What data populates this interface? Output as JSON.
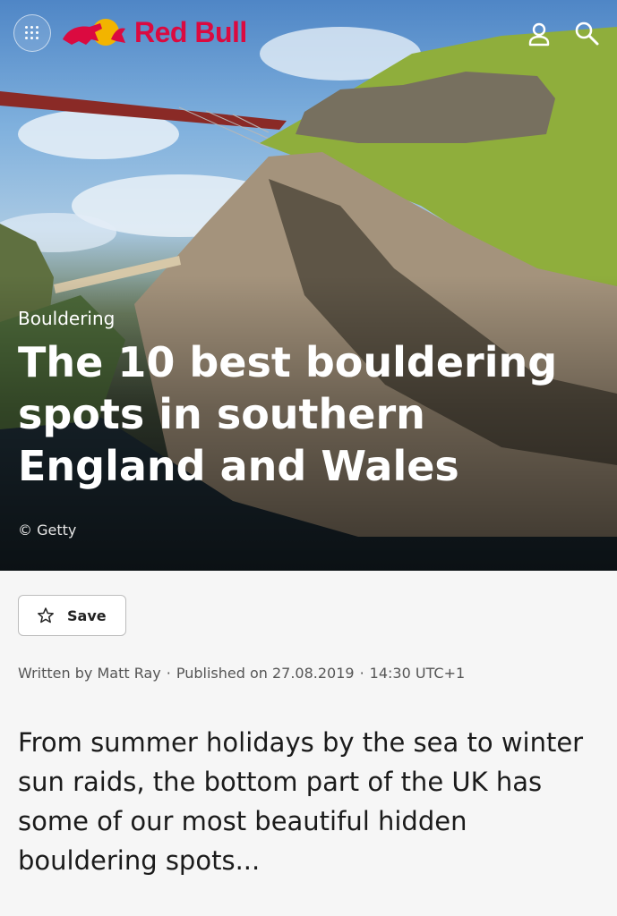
{
  "header": {
    "logo_text": "Red Bull",
    "icons": [
      "menu-grid-icon",
      "bull-logo-icon",
      "user-icon",
      "search-icon"
    ]
  },
  "hero": {
    "category": "Bouldering",
    "title": "The 10 best bouldering spots in southern England and Wales",
    "credit": "© Getty"
  },
  "actions": {
    "save_label": "Save"
  },
  "byline": {
    "author": "Written by Matt Ray",
    "published": "Published on 27.08.2019",
    "time": "14:30 UTC+1"
  },
  "intro": "From summer holidays by the sea to winter sun raids, the bottom part of the UK has some of our most beautiful hidden bouldering spots...",
  "colors": {
    "brand_red": "#db0a40",
    "brand_yellow": "#f2b400",
    "page_bg": "#f6f6f6"
  }
}
